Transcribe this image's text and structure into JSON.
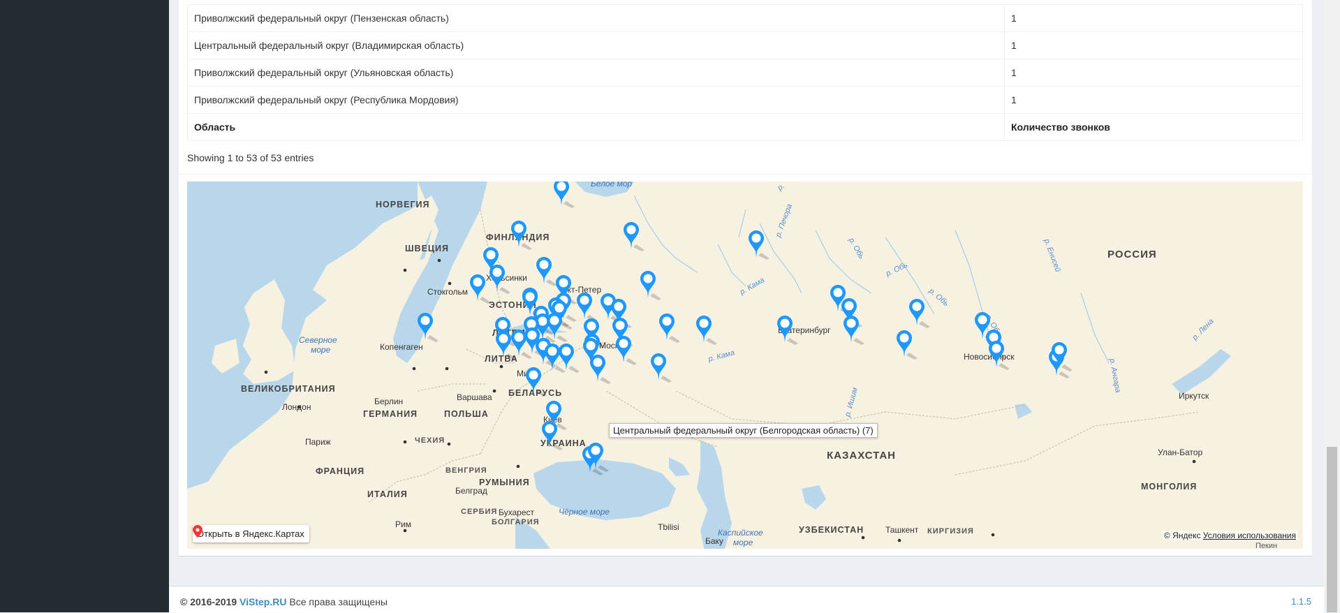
{
  "table": {
    "rows": [
      {
        "region": "Приволжский федеральный округ (Пензенская область)",
        "calls": "1"
      },
      {
        "region": "Центральный федеральный округ (Владимирская область)",
        "calls": "1"
      },
      {
        "region": "Приволжский федеральный округ (Ульяновская область)",
        "calls": "1"
      },
      {
        "region": "Приволжский федеральный округ (Республика Мордовия)",
        "calls": "1"
      }
    ],
    "footer_header": {
      "region": "Область",
      "calls": "Количество звонков"
    }
  },
  "info_text": "Showing 1 to 53 of 53 entries",
  "map": {
    "labels": {
      "norway": "НОРВЕГИЯ",
      "finland": "ФИНЛЯНДИЯ",
      "sweden": "ШВЕЦИЯ",
      "helsinki": "Хельсинки",
      "stockholm": "Стокгольм",
      "estonia": "ЭСТОНИЯ",
      "latvia": "ЛАТВИЯ",
      "lithuania": "ЛИТВА",
      "copenhagen": "Копенгаген",
      "north_sea_1": "Северное",
      "north_sea_2": "море",
      "uk": "ВЕЛИКОБРИТАНИЯ",
      "london": "Лондон",
      "minsk": "Минск",
      "belarus": "БЕЛАРУСЬ",
      "berlin": "Берлин",
      "warsaw": "Варшава",
      "germany": "ГЕРМАНИЯ",
      "poland": "ПОЛЬША",
      "kiev": "Киев",
      "ukraine": "УКРАИНА",
      "paris": "Париж",
      "czech": "ЧЕХИЯ",
      "france": "ФРАНЦИЯ",
      "hungary": "ВЕНГРИЯ",
      "romania": "РУМЫНИЯ",
      "italy": "ИТАЛИЯ",
      "belgrade": "Белград",
      "serbia": "СЕРБИЯ",
      "bucharest": "Бухарест",
      "bulgaria": "БОЛГАРИЯ",
      "rome": "Рим",
      "black_sea": "Чёрное море",
      "tbilisi": "Tbilisi",
      "baku": "Баку",
      "caspian_1": "Каспийское",
      "caspian_2": "море",
      "uzbekistan": "УЗБЕКИСТАН",
      "tashkent": "Ташкент",
      "kyrgyzstan": "КИРГИЗИЯ",
      "kazakhstan": "КАЗАХСТАН",
      "mongolia": "МОНГОЛИЯ",
      "ulanbator": "Улан-Батор",
      "beijing": "Пекин",
      "russia": "РОССИЯ",
      "moscow": "Моск",
      "spb": "нкт-Петер",
      "ekb": "Екатеринбург",
      "nsk": "Новосибирск",
      "irkutsk": "Иркутск",
      "white_sea": "Белое мор",
      "river_pechora": "р. Печора",
      "river_kama1": "р. Кама",
      "river_kama2": "р. Кама",
      "river_ob1": "р. Обь",
      "river_ob2": "р. Обь",
      "river_ob3": "р. Обь",
      "river_ob4": "р. Обь",
      "river_enisey": "р. Енисей",
      "river_lena": "р. Лена",
      "river_angara": "р. Ангара",
      "river_ishim": "р. Ишим",
      "river_p": "р."
    },
    "tooltip": "Центральный федеральный округ (Белгородская область) (7)",
    "open_button": "Открыть в Яндекс.Картах",
    "copyright_brand": "© Яндекс",
    "copyright_link": "Условия использования",
    "accent_color": "#1e98ff"
  },
  "footer": {
    "years": "© 2016-2019",
    "brand": "ViStep.RU",
    "rights": "Все права защищены",
    "version": "1.1.5"
  }
}
